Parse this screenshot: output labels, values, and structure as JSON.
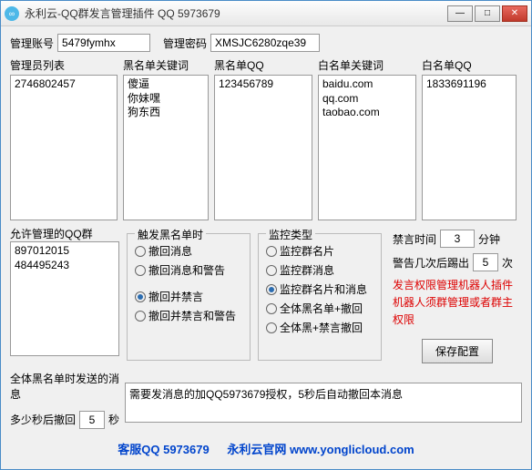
{
  "window": {
    "title": "永利云-QQ群发言管理插件 QQ 5973679"
  },
  "account": {
    "label": "管理账号",
    "value": "5479fymhx",
    "pwdLabel": "管理密码",
    "pwdValue": "XMSJC6280zqe39"
  },
  "adminList": {
    "header": "管理员列表",
    "items": "2746802457"
  },
  "blacklistKw": {
    "header": "黑名单关键词",
    "items": "傻逼\n你妹嘿\n狗东西"
  },
  "blacklistQQ": {
    "header": "黑名单QQ",
    "items": "123456789"
  },
  "whitelistKw": {
    "header": "白名单关键词",
    "items": "baidu.com\nqq.com\ntaobao.com"
  },
  "whitelistQQ": {
    "header": "白名单QQ",
    "items": "1833691196"
  },
  "allowGroups": {
    "header": "允许管理的QQ群",
    "items": "897012015\n484495243"
  },
  "blkTrigger": {
    "legend": "触发黑名单时",
    "opt1": "撤回消息",
    "opt2": "撤回消息和警告",
    "opt3": "撤回并禁言",
    "opt4": "撤回并禁言和警告"
  },
  "monType": {
    "legend": "监控类型",
    "opt1": "监控群名片",
    "opt2": "监控群消息",
    "opt3": "监控群名片和消息",
    "opt4": "全体黑名单+撤回",
    "opt5": "全体黑+禁言撤回"
  },
  "right": {
    "muteLabel": "禁言时间",
    "muteVal": "3",
    "muteUnit": "分钟",
    "warnLabel": "警告几次后踢出",
    "warnVal": "5",
    "warnUnit": "次",
    "note1": "发言权限管理机器人插件",
    "note2": "机器人须群管理或者群主权限",
    "saveBtn": "保存配置"
  },
  "bottom": {
    "sendLabel": "全体黑名单时发送的消息",
    "msg": "需要发消息的加QQ5973679授权，5秒后自动撤回本消息",
    "recallLabel": "多少秒后撤回",
    "recallVal": "5",
    "recallUnit": "秒"
  },
  "footer": {
    "svc": "客服QQ 5973679",
    "site": "永利云官网 www.yonglicloud.com"
  }
}
